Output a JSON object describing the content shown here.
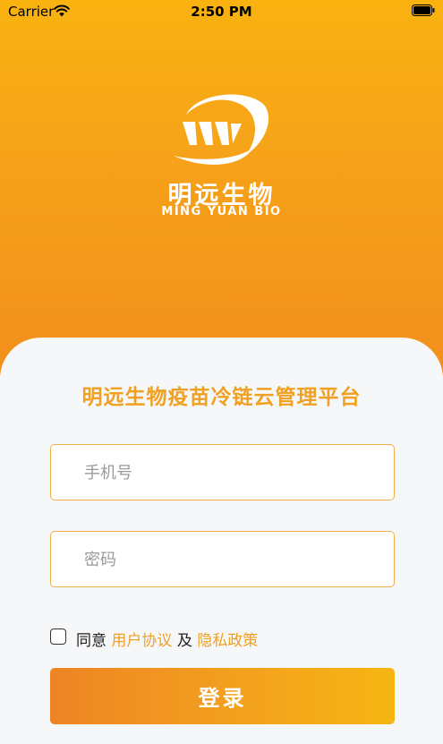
{
  "status_bar": {
    "carrier": "Carrier",
    "time": "2:50 PM"
  },
  "brand": {
    "name_cn": "明远生物",
    "name_en": "MING YUAN BIO"
  },
  "login": {
    "title": "明远生物疫苗冷链云管理平台",
    "phone_placeholder": "手机号",
    "password_placeholder": "密码",
    "agree_label": "同意",
    "user_agreement": "用户协议",
    "and": "及",
    "privacy_policy": "隐私政策",
    "submit_label": "登录"
  },
  "colors": {
    "accent": "#f0a022",
    "gradient_top": "#f9b210",
    "gradient_bottom": "#f18f1c"
  }
}
